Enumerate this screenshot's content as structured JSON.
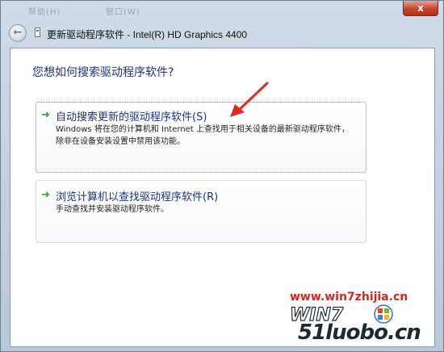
{
  "titlebar": {
    "faint_menu_left": "帮助(H)",
    "faint_menu_right": "窗口(W)",
    "close_label": "x"
  },
  "nav": {
    "back_glyph": "←",
    "title": "更新驱动程序软件 - Intel(R) HD Graphics 4400"
  },
  "main": {
    "question": "您想如何搜索驱动程序软件?",
    "options": [
      {
        "title": "自动搜索更新的驱动程序软件(S)",
        "desc": "Windows 将在您的计算机和 Internet 上查找用于相关设备的最新驱动程序软件，除非在设备安装设置中禁用该功能。"
      },
      {
        "title": "浏览计算机以查找驱动程序软件(R)",
        "desc": "手动查找并安装驱动程序软件。"
      }
    ],
    "arrow_glyph": "➜"
  },
  "watermark": {
    "url": "www.win7zhijia.cn",
    "logo_text": "WIN7",
    "site": "51luobo.cn"
  },
  "colors": {
    "link_blue": "#1e3287",
    "arrow_green": "#2ea43a",
    "pointer_red": "#e02a22"
  },
  "icons": [
    "back-arrow-icon",
    "device-icon",
    "green-arrow-icon",
    "red-pointer-icon",
    "windows-flag-icon"
  ]
}
